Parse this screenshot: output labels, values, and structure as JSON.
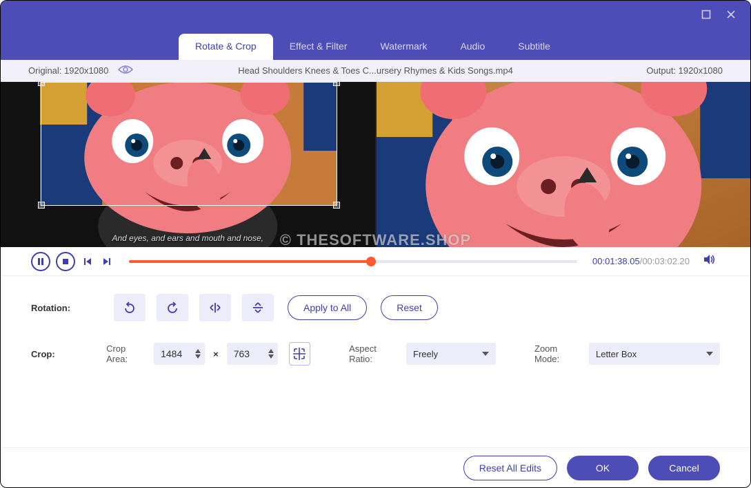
{
  "tabs": {
    "rotate_crop": "Rotate & Crop",
    "effect_filter": "Effect & Filter",
    "watermark": "Watermark",
    "audio": "Audio",
    "subtitle": "Subtitle"
  },
  "info": {
    "original_label": "Original: 1920x1080",
    "filename": "Head Shoulders Knees & Toes  C...ursery Rhymes & Kids Songs.mp4",
    "output_label": "Output: 1920x1080"
  },
  "preview": {
    "subtitle_text": "And eyes, and ears and mouth and nose,"
  },
  "watermark_text": "© THESOFTWARE.SHOP",
  "playback": {
    "current": "00:01:38.05",
    "total": "/00:03:02.20",
    "progress_pct": 54
  },
  "rotation": {
    "label": "Rotation:",
    "apply_all": "Apply to All",
    "reset": "Reset"
  },
  "crop": {
    "label": "Crop:",
    "area_label": "Crop Area:",
    "width": "1484",
    "height": "763",
    "aspect_label": "Aspect Ratio:",
    "aspect_value": "Freely",
    "zoom_label": "Zoom Mode:",
    "zoom_value": "Letter Box"
  },
  "footer": {
    "reset_all": "Reset All Edits",
    "ok": "OK",
    "cancel": "Cancel"
  }
}
